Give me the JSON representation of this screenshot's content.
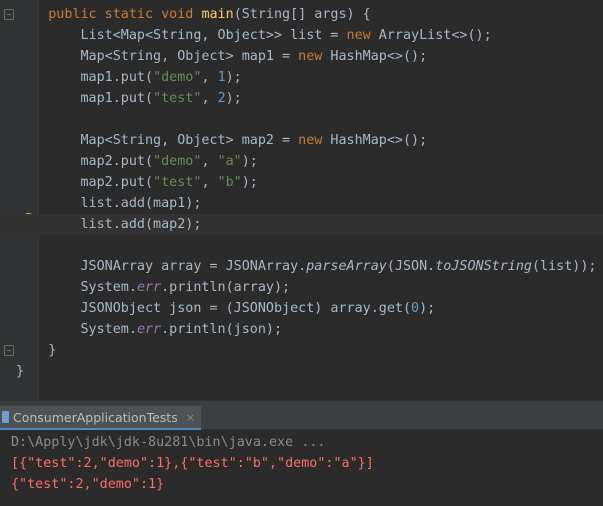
{
  "editor": {
    "lines": [
      {
        "id": "l1",
        "segments": [
          {
            "t": "    ",
            "c": ""
          },
          {
            "t": "public static void ",
            "c": "kw"
          },
          {
            "t": "main",
            "c": "fn"
          },
          {
            "t": "(String[] args) {",
            "c": ""
          }
        ]
      },
      {
        "id": "l2",
        "segments": [
          {
            "t": "        List<Map<String, Object>> list = ",
            "c": ""
          },
          {
            "t": "new ",
            "c": "kw"
          },
          {
            "t": "ArrayList<>();",
            "c": ""
          }
        ]
      },
      {
        "id": "l3",
        "segments": [
          {
            "t": "        Map<String, Object> map1 = ",
            "c": ""
          },
          {
            "t": "new ",
            "c": "kw"
          },
          {
            "t": "HashMap<>();",
            "c": ""
          }
        ]
      },
      {
        "id": "l4",
        "segments": [
          {
            "t": "        map1.put(",
            "c": ""
          },
          {
            "t": "\"demo\"",
            "c": "str"
          },
          {
            "t": ", ",
            "c": ""
          },
          {
            "t": "1",
            "c": "num"
          },
          {
            "t": ");",
            "c": ""
          }
        ]
      },
      {
        "id": "l5",
        "segments": [
          {
            "t": "        map1.put(",
            "c": ""
          },
          {
            "t": "\"test\"",
            "c": "str"
          },
          {
            "t": ", ",
            "c": ""
          },
          {
            "t": "2",
            "c": "num"
          },
          {
            "t": ");",
            "c": ""
          }
        ]
      },
      {
        "id": "l6",
        "segments": []
      },
      {
        "id": "l7",
        "segments": [
          {
            "t": "        Map<String, Object> map2 = ",
            "c": ""
          },
          {
            "t": "new ",
            "c": "kw"
          },
          {
            "t": "HashMap<>();",
            "c": ""
          }
        ]
      },
      {
        "id": "l8",
        "segments": [
          {
            "t": "        map2.put(",
            "c": ""
          },
          {
            "t": "\"demo\"",
            "c": "str"
          },
          {
            "t": ", ",
            "c": ""
          },
          {
            "t": "\"a\"",
            "c": "str"
          },
          {
            "t": ");",
            "c": ""
          }
        ]
      },
      {
        "id": "l9",
        "segments": [
          {
            "t": "        map2.put(",
            "c": ""
          },
          {
            "t": "\"test\"",
            "c": "str"
          },
          {
            "t": ", ",
            "c": ""
          },
          {
            "t": "\"b\"",
            "c": "str"
          },
          {
            "t": ");",
            "c": ""
          }
        ]
      },
      {
        "id": "l10",
        "segments": [
          {
            "t": "        list.add(map1);",
            "c": ""
          }
        ]
      },
      {
        "id": "l11",
        "segments": [
          {
            "t": "        list.add(map2);",
            "c": ""
          }
        ]
      },
      {
        "id": "l12",
        "segments": []
      },
      {
        "id": "l13",
        "segments": [
          {
            "t": "        JSONArray array = JSONArray.",
            "c": ""
          },
          {
            "t": "parseArray",
            "c": "it"
          },
          {
            "t": "(JSON.",
            "c": ""
          },
          {
            "t": "toJSONString",
            "c": "it"
          },
          {
            "t": "(list));",
            "c": ""
          }
        ]
      },
      {
        "id": "l14",
        "segments": [
          {
            "t": "        System.",
            "c": ""
          },
          {
            "t": "err",
            "c": "fld"
          },
          {
            "t": ".println(array);",
            "c": ""
          }
        ]
      },
      {
        "id": "l15",
        "segments": [
          {
            "t": "        JSONObject json = (JSONObject) array.get(",
            "c": ""
          },
          {
            "t": "0",
            "c": "num"
          },
          {
            "t": ");",
            "c": ""
          }
        ]
      },
      {
        "id": "l16",
        "segments": [
          {
            "t": "        System.",
            "c": ""
          },
          {
            "t": "err",
            "c": "fld"
          },
          {
            "t": ".println(json);",
            "c": ""
          }
        ]
      },
      {
        "id": "l17",
        "segments": [
          {
            "t": "    }",
            "c": ""
          }
        ]
      },
      {
        "id": "l18",
        "segments": [
          {
            "t": "}",
            "c": ""
          }
        ]
      }
    ]
  },
  "run_tab": {
    "label": "ConsumerApplicationTests",
    "close_glyph": "×"
  },
  "console": {
    "command": "D:\\Apply\\jdk\\jdk-8u281\\bin\\java.exe ...",
    "output_1": "[{\"test\":2,\"demo\":1},{\"test\":\"b\",\"demo\":\"a\"}]",
    "output_2": "{\"test\":2,\"demo\":1}"
  },
  "colors": {
    "keyword": "#cc7832",
    "string": "#6a8759",
    "number": "#6897bb",
    "method_decl": "#ffc66d",
    "static_field": "#9876aa",
    "default_text": "#a9b7c6",
    "stderr": "#ff6b68"
  }
}
